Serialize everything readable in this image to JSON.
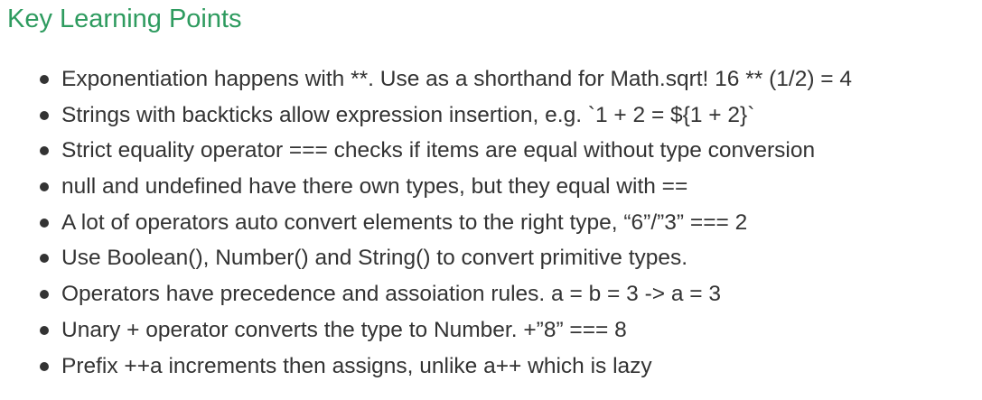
{
  "section": {
    "title": "Key Learning Points"
  },
  "points": [
    "Exponentiation happens with **. Use as a shorthand for Math.sqrt! 16 ** (1/2) = 4",
    "Strings with backticks allow expression insertion, e.g. `1 + 2 = ${1 + 2}`",
    "Strict equality operator === checks if items are equal without type conversion",
    "null and undefined have there own types, but they equal with ==",
    "A lot of operators auto convert elements to the right type, “6”/”3” === 2",
    "Use Boolean(), Number() and String() to convert primitive types.",
    "Operators have precedence and assoiation rules. a = b = 3 -> a = 3",
    "Unary + operator converts the type to Number. +”8” === 8",
    "Prefix ++a increments then assigns, unlike a++ which is lazy"
  ]
}
